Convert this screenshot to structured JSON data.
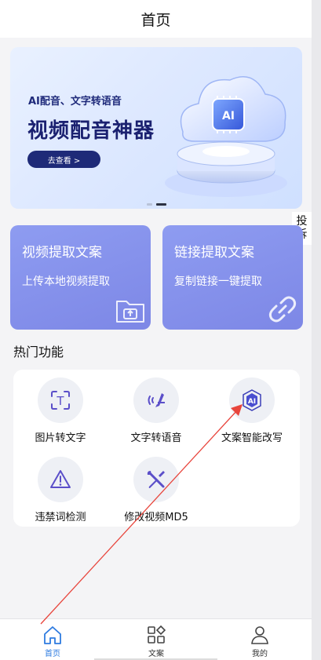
{
  "header": {
    "title": "首页"
  },
  "banner": {
    "tag": "AI配音、文字转语音",
    "headline": "视频配音神器",
    "cta": "去查看 >",
    "art_badge": "AI",
    "slide_count": 2,
    "active_slide": 2
  },
  "side_button": {
    "line1": "投",
    "line2": "诉"
  },
  "cards": [
    {
      "title": "视频提取文案",
      "subtitle": "上传本地视频提取",
      "icon": "folder-upload-icon"
    },
    {
      "title": "链接提取文案",
      "subtitle": "复制链接一键提取",
      "icon": "link-icon"
    }
  ],
  "section": {
    "title": "热门功能"
  },
  "tools": [
    {
      "label": "图片转文字",
      "icon": "image-to-text-icon",
      "badge": "T"
    },
    {
      "label": "文字转语音",
      "icon": "text-to-speech-icon"
    },
    {
      "label": "文案智能改写",
      "icon": "ai-rewrite-icon",
      "badge": "AI"
    },
    {
      "label": "违禁词检测",
      "icon": "warning-icon"
    },
    {
      "label": "修改视频MD5",
      "icon": "tools-icon"
    }
  ],
  "tabbar": {
    "items": [
      {
        "label": "首页",
        "icon": "home-icon",
        "active": true
      },
      {
        "label": "文案",
        "icon": "apps-icon",
        "active": false
      },
      {
        "label": "我的",
        "icon": "user-icon",
        "active": false
      }
    ]
  },
  "colors": {
    "accent": "#2e7be0",
    "card_gradient_start": "#8e9cf1",
    "card_gradient_end": "#7d87e6",
    "banner_navy": "#1e2a78",
    "annotation_arrow": "#e8453c"
  }
}
